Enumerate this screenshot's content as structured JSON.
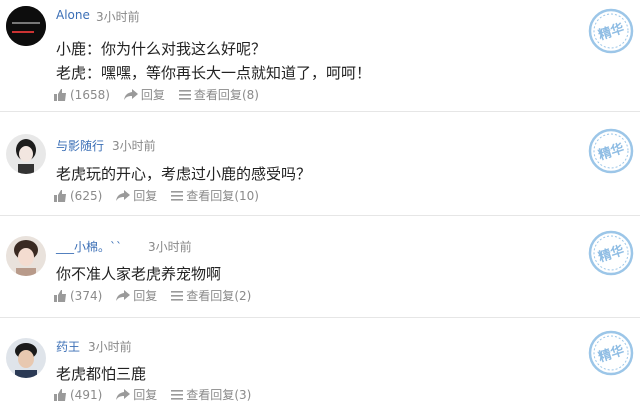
{
  "badge_label": "精华",
  "actions": {
    "reply_label": "回复",
    "view_replies_label": "查看回复"
  },
  "comments": [
    {
      "username": "Alone",
      "time": "3小时前",
      "lines": [
        "小鹿：你为什么对我这么好呢？",
        "老虎：嘿嘿，等你再长大一点就知道了，呵呵！"
      ],
      "likes": "(1658)",
      "reply_count": "(8)"
    },
    {
      "username": "与影随行",
      "time": "3小时前",
      "lines": [
        "老虎玩的开心，考虑过小鹿的感受吗？"
      ],
      "likes": "(625)",
      "reply_count": "(10)"
    },
    {
      "username": "___小棉。ˋˋ",
      "time": "3小时前",
      "lines": [
        "你不准人家老虎养宠物啊"
      ],
      "likes": "(374)",
      "reply_count": "(2)"
    },
    {
      "username": "药王",
      "time": "3小时前",
      "lines": [
        "老虎都怕三鹿"
      ],
      "likes": "(491)",
      "reply_count": "(3)"
    }
  ],
  "colors": {
    "username": "#3b6fb6",
    "badge": "#9cc6e8",
    "meta": "#8a8a8a"
  }
}
